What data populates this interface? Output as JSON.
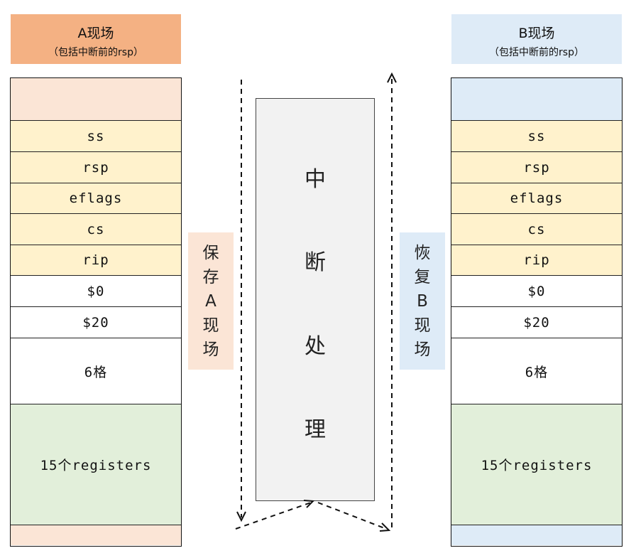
{
  "left": {
    "title": "A现场",
    "subtitle": "（包括中断前的rsp）",
    "colors": {
      "header": "#f4b183",
      "top": "#fbe5d6",
      "bottom": "#fbe5d6"
    },
    "cells": [
      "",
      "ss",
      "rsp",
      "eflags",
      "cs",
      "rip",
      "$0",
      "$20",
      "6格",
      "15个registers",
      ""
    ]
  },
  "right": {
    "title": "B现场",
    "subtitle": "（包括中断前的rsp）",
    "colors": {
      "header": "#deebf7",
      "top": "#deebf7",
      "bottom": "#deebf7"
    },
    "cells": [
      "",
      "ss",
      "rsp",
      "eflags",
      "cs",
      "rip",
      "$0",
      "$20",
      "6格",
      "15个registers",
      ""
    ]
  },
  "cell_colors": {
    "hw": "#fff2cc",
    "plain": "#ffffff",
    "regs": "#e2efda"
  },
  "save_label": [
    "保",
    "存",
    "A",
    "现",
    "场"
  ],
  "save_color": "#fbe5d6",
  "restore_label": [
    "恢",
    "复",
    "B",
    "现",
    "场"
  ],
  "restore_color": "#deebf7",
  "center_label": [
    "中",
    "断",
    "处",
    "理"
  ],
  "center_color": "#f2f2f2"
}
